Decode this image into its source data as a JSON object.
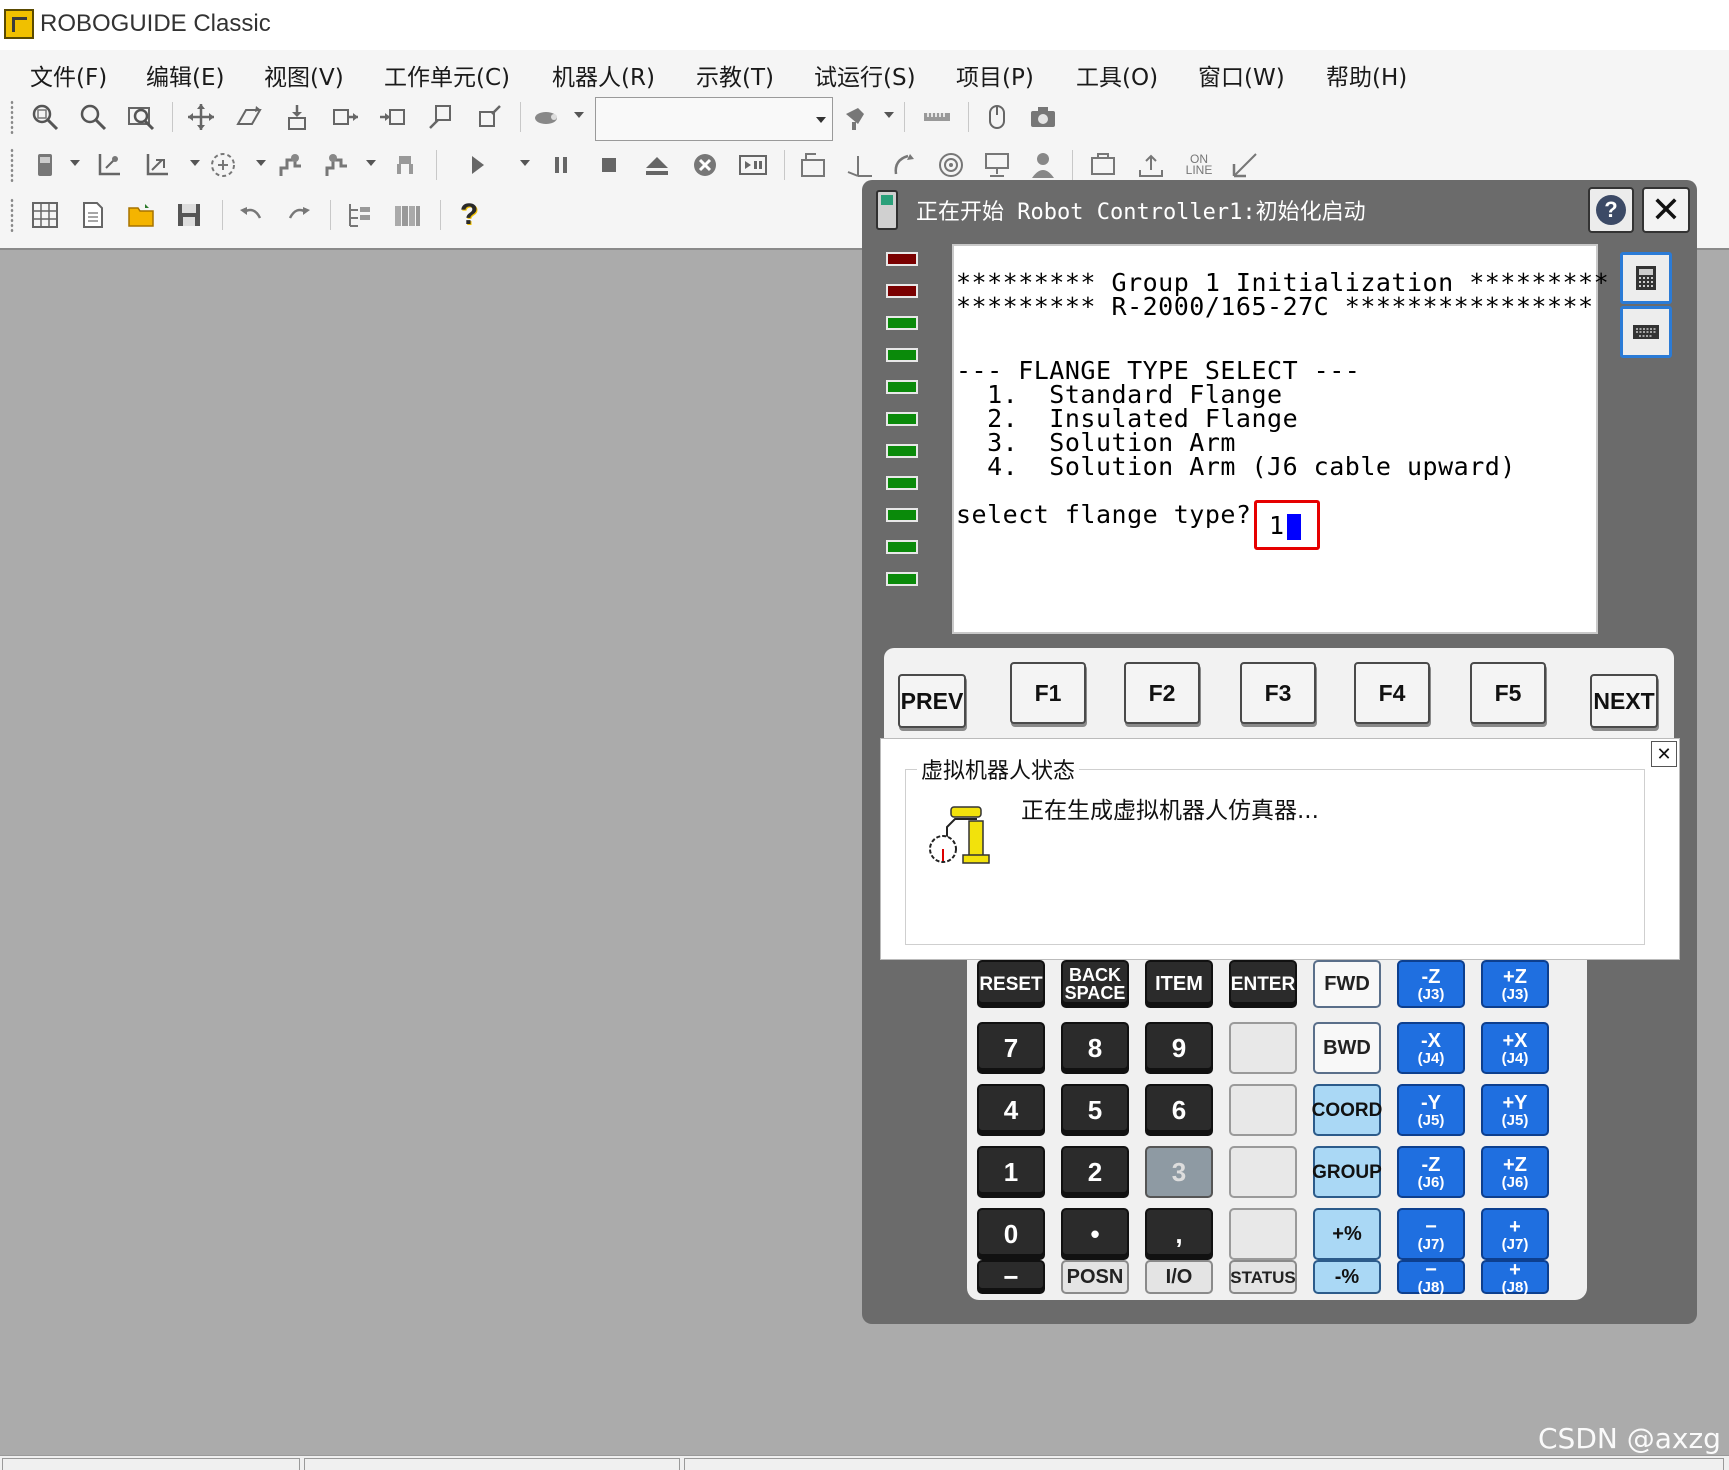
{
  "app": {
    "title": "ROBOGUIDE Classic"
  },
  "menu": [
    {
      "label": "文件(F)"
    },
    {
      "label": "编辑(E)"
    },
    {
      "label": "视图(V)"
    },
    {
      "label": "工作单元(C)"
    },
    {
      "label": "机器人(R)"
    },
    {
      "label": "示教(T)"
    },
    {
      "label": "试运行(S)"
    },
    {
      "label": "项目(P)"
    },
    {
      "label": "工具(O)"
    },
    {
      "label": "窗口(W)"
    },
    {
      "label": "帮助(H)"
    }
  ],
  "toolbar": {
    "view_combo_value": "",
    "online_label": "ON LINE",
    "help_icon_glyph": "?"
  },
  "pendant": {
    "title": "正在开始 Robot Controller1:初始化启动",
    "help_glyph": "?",
    "close_glyph": "✕",
    "leds": [
      "red",
      "red",
      "green",
      "green",
      "green",
      "green",
      "green",
      "green",
      "green",
      "green",
      "green"
    ],
    "screen": {
      "line1": "********* Group 1 Initialization *********",
      "line2": "********* R-2000/165-27C ****************",
      "line3": "--- FLANGE TYPE SELECT ---",
      "line4": "  1.  Standard Flange",
      "line5": "  2.  Insulated Flange",
      "line6": "  3.  Solution Arm",
      "line7": "  4.  Solution Arm (J6 cable upward)",
      "prompt": "select flange type?",
      "input_value": "1"
    },
    "fkeys": {
      "prev": "PREV",
      "f1": "F1",
      "f2": "F2",
      "f3": "F3",
      "f4": "F4",
      "f5": "F5",
      "next": "NEXT"
    },
    "keypad": {
      "reset": "RESET",
      "backspace_1": "BACK",
      "backspace_2": "SPACE",
      "item": "ITEM",
      "enter": "ENTER",
      "fwd": "FWD",
      "j3_minus_top": "-Z",
      "j3_minus_bot": "(J3)",
      "j3_plus_top": "+Z",
      "j3_plus_bot": "(J3)",
      "n7": "7",
      "n8": "8",
      "n9": "9",
      "bwd": "BWD",
      "j4_minus_top": "-X",
      "j4_minus_bot": "(J4)",
      "j4_plus_top": "+X",
      "j4_plus_bot": "(J4)",
      "n4": "4",
      "n5": "5",
      "n6": "6",
      "coord": "COORD",
      "j5_minus_top": "-Y",
      "j5_minus_bot": "(J5)",
      "j5_plus_top": "+Y",
      "j5_plus_bot": "(J5)",
      "n1": "1",
      "n2": "2",
      "n3": "3",
      "group": "GROUP",
      "j6_minus_top": "-Z",
      "j6_minus_bot": "(J6)",
      "j6_plus_top": "+Z",
      "j6_plus_bot": "(J6)",
      "n0": "0",
      "dot": "•",
      "comma": ",",
      "speed_up": "+%",
      "j7_minus_top": "−",
      "j7_minus_bot": "(J7)",
      "j7_plus_top": "+",
      "j7_plus_bot": "(J7)",
      "minus": "−",
      "posn": "POSN",
      "io": "I/O",
      "status": "STATUS",
      "speed_down": "-%",
      "j8_minus_top": "−",
      "j8_minus_bot": "(J8)",
      "j8_plus_top": "+",
      "j8_plus_bot": "(J8)"
    }
  },
  "status_panel": {
    "legend": "虚拟机器人状态",
    "message": "正在生成虚拟机器人仿真器...",
    "close_glyph": "✕"
  },
  "watermark": "CSDN @axzg"
}
